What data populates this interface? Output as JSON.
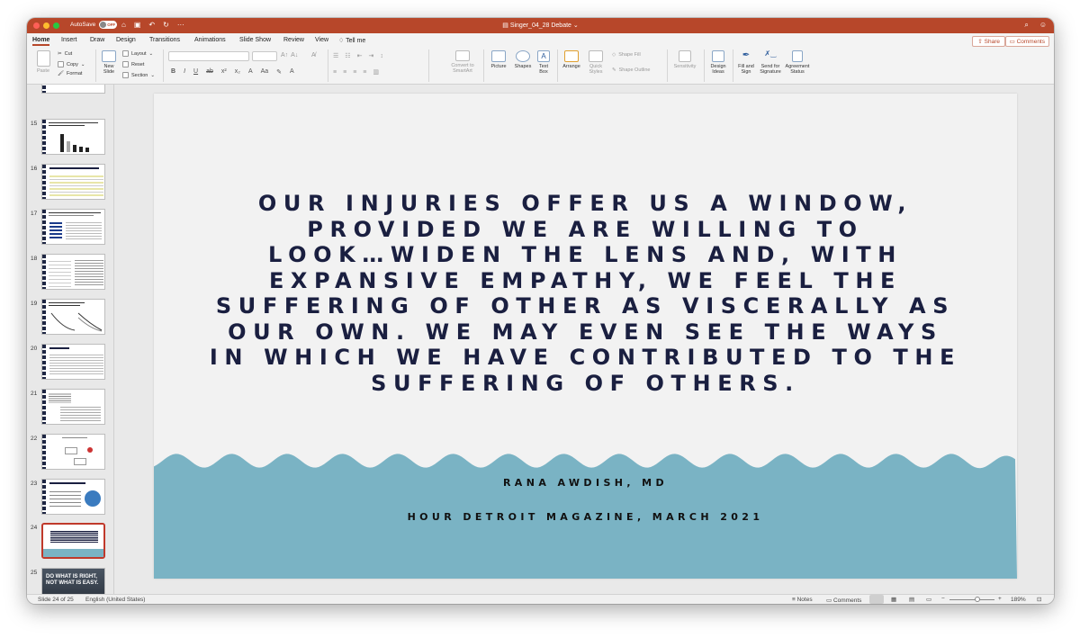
{
  "app": {
    "autosave_label": "AutoSave",
    "autosave_state": "OFF",
    "doc_title": "Singer_04_28 Debate",
    "title_icons": [
      "home-icon",
      "save-icon",
      "undo-icon",
      "redo-icon",
      "more-icon"
    ]
  },
  "tabs": [
    "Home",
    "Insert",
    "Draw",
    "Design",
    "Transitions",
    "Animations",
    "Slide Show",
    "Review",
    "View"
  ],
  "tell_me": "Tell me",
  "share_label": "Share",
  "comments_label": "Comments",
  "ribbon": {
    "paste": "Paste",
    "cut": "Cut",
    "copy": "Copy",
    "format": "Format",
    "new_slide_1": "New",
    "new_slide_2": "Slide",
    "layout": "Layout",
    "reset": "Reset",
    "section": "Section",
    "convert_1": "Convert to",
    "convert_2": "SmartArt",
    "picture": "Picture",
    "shapes": "Shapes",
    "textbox_1": "Text",
    "textbox_2": "Box",
    "arrange": "Arrange",
    "quick_styles_1": "Quick",
    "quick_styles_2": "Styles",
    "shape_fill": "Shape Fill",
    "shape_outline": "Shape Outline",
    "sensitivity": "Sensitivity",
    "design_ideas_1": "Design",
    "design_ideas_2": "Ideas",
    "fill_sign_1": "Fill and",
    "fill_sign_2": "Sign",
    "send_sig_1": "Send for",
    "send_sig_2": "Signature",
    "agreement_1": "Agreement",
    "agreement_2": "Status"
  },
  "thumbnails": [
    {
      "num": "15",
      "title": "Outcomes shows no lower overdose rates at one year follow up..."
    },
    {
      "num": "16",
      "title": "SUBSTANCE USE AND IV OUTCOMES"
    },
    {
      "num": "17",
      "title": "Rates of opioid overdose..."
    },
    {
      "num": "18",
      "title": ""
    },
    {
      "num": "19",
      "title": "Impact of the opioid crisis..."
    },
    {
      "num": "20",
      "title": "ADHERENCE"
    },
    {
      "num": "21",
      "title": ""
    },
    {
      "num": "22",
      "title": ""
    },
    {
      "num": "23",
      "title": "THINK ABOUT THE PAST YEAR..."
    },
    {
      "num": "24",
      "title": ""
    },
    {
      "num": "25",
      "title": "DO WHAT IS RIGHT, NOT WHAT IS EASY."
    }
  ],
  "slide": {
    "quote_lines": [
      "OUR INJURIES OFFER US A WINDOW,",
      "PROVIDED WE ARE WILLING TO",
      "LOOK…WIDEN THE LENS AND, WITH",
      "EXPANSIVE EMPATHY, WE FEEL THE",
      "SUFFERING OF OTHER AS VISCERALLY AS",
      "OUR OWN. WE MAY EVEN SEE THE WAYS",
      "IN WHICH WE HAVE CONTRIBUTED TO THE",
      "SUFFERING OF OTHERS."
    ],
    "author": "RANA AWDISH, MD",
    "source": "HOUR DETROIT MAGAZINE, MARCH 2021",
    "colors": {
      "background": "#f2f2f2",
      "wave": "#7ab3c4",
      "text": "#1a1f40"
    }
  },
  "status": {
    "slide_info": "Slide 24 of 25",
    "language": "English (United States)",
    "notes": "Notes",
    "comments": "Comments",
    "zoom": "189%"
  }
}
